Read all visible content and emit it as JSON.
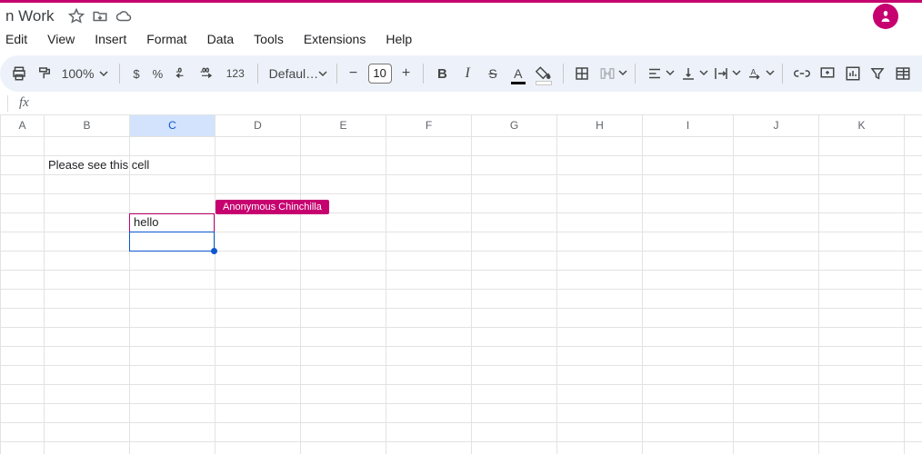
{
  "accent": "#c6006f",
  "doc": {
    "title": "n Work"
  },
  "menu": {
    "edit": "Edit",
    "view": "View",
    "insert": "Insert",
    "format": "Format",
    "data": "Data",
    "tools": "Tools",
    "extensions": "Extensions",
    "help": "Help"
  },
  "toolbar": {
    "zoom": "100%",
    "currency": "$",
    "percent": "%",
    "number_format_123": "123",
    "font_name": "Defaul…",
    "font_size": "10"
  },
  "formula_bar": {
    "fx": "fx",
    "value": ""
  },
  "columns": [
    "A",
    "B",
    "C",
    "D",
    "E",
    "F",
    "G",
    "H",
    "I",
    "J",
    "K"
  ],
  "selected_column_index": 2,
  "cells": {
    "B2": "Please see this cell",
    "C5": "hello"
  },
  "collaborator": {
    "name": "Anonymous Chinchilla",
    "cell": "C5"
  },
  "selection": {
    "cell": "C6"
  },
  "row_count": 17
}
